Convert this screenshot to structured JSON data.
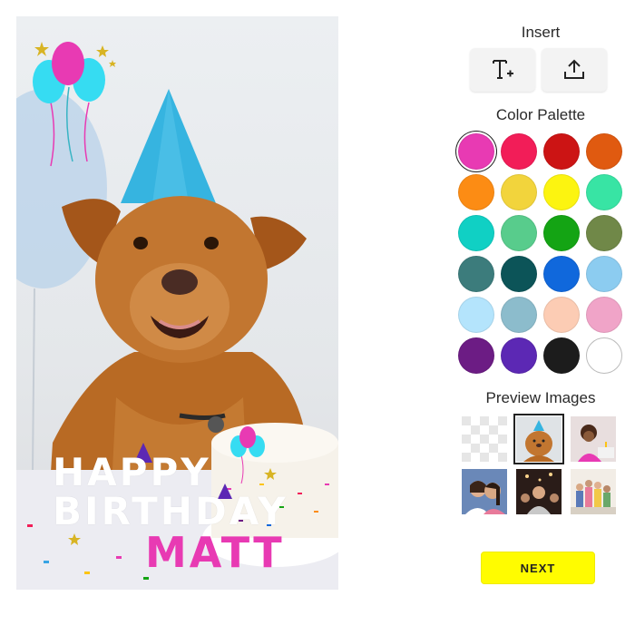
{
  "canvas": {
    "greeting_line1": "HAPPY",
    "greeting_line2": "BIRTHDAY",
    "greeting_name": "MATT"
  },
  "panel": {
    "insert_title": "Insert",
    "insert_buttons": [
      {
        "icon": "add-text-icon"
      },
      {
        "icon": "upload-icon"
      }
    ],
    "palette_title": "Color Palette",
    "palette": [
      "#e83ab3",
      "#f21d58",
      "#cc1414",
      "#e05a10",
      "#fc8c14",
      "#f2d43c",
      "#fcf410",
      "#38e4a4",
      "#10d0c4",
      "#58cc8c",
      "#14a414",
      "#708848",
      "#3c7c7c",
      "#0c5458",
      "#1068dc",
      "#8cccf0",
      "#b4e4fc",
      "#8cbccc",
      "#fcccb4",
      "#f0a4c8",
      "#6c1c84",
      "#5c28b4",
      "#1c1c1c",
      "#ffffff"
    ],
    "selected_color": "#e83ab3",
    "preview_title": "Preview Images",
    "next_label": "NEXT"
  }
}
